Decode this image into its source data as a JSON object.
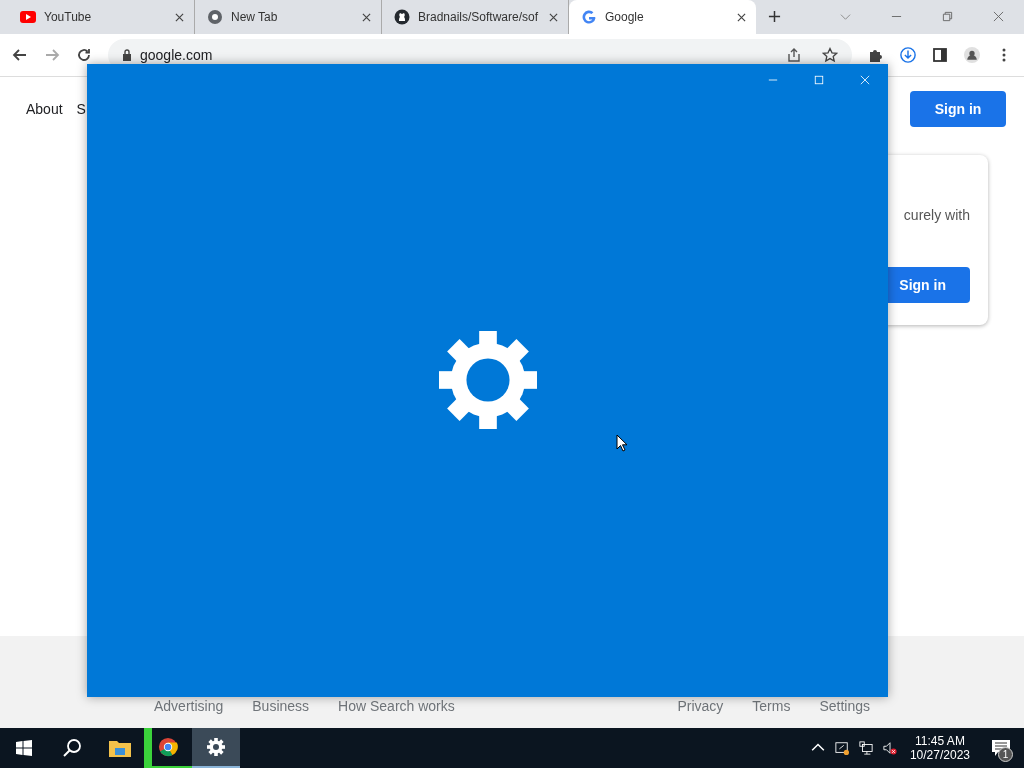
{
  "browser": {
    "tabs": [
      {
        "title": "YouTube",
        "kind": "youtube",
        "selected": false
      },
      {
        "title": "New Tab",
        "kind": "chrome",
        "selected": false
      },
      {
        "title": "Bradnails/Software/sof",
        "kind": "github",
        "selected": false
      },
      {
        "title": "Google",
        "kind": "google",
        "selected": true
      }
    ],
    "address": "google.com",
    "page": {
      "nav_links": [
        "About",
        "S"
      ],
      "sign_in": "Sign in",
      "card": {
        "text": "curely with",
        "button": "Sign in"
      },
      "footer_left": [
        "Advertising",
        "Business",
        "How Search works"
      ],
      "footer_right": [
        "Privacy",
        "Terms",
        "Settings"
      ]
    }
  },
  "settings_window": {
    "kind": "loading"
  },
  "taskbar": {
    "apps": [
      {
        "kind": "explorer",
        "flashing": false,
        "selected": false
      },
      {
        "kind": "chrome",
        "flashing": true,
        "selected": false
      },
      {
        "kind": "settings",
        "flashing": false,
        "selected": true
      }
    ],
    "time": "11:45 AM",
    "date": "10/27/2023",
    "notifications": "1"
  }
}
